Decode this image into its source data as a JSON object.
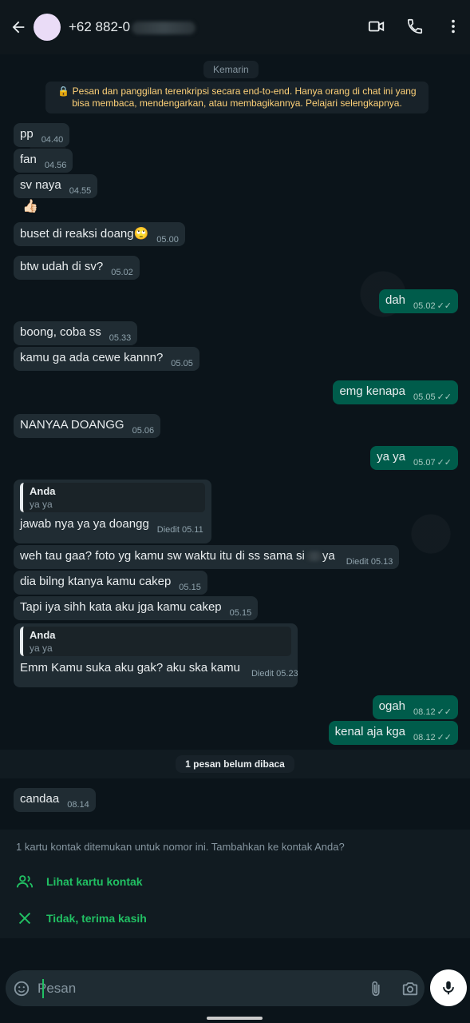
{
  "header": {
    "contact_name": "+62 882-0",
    "icons": [
      "back-arrow-icon",
      "video-call-icon",
      "phone-icon",
      "more-vert-icon"
    ]
  },
  "chat": {
    "date_chip": "Kemarin",
    "encryption_notice": "🔒 Pesan dan panggilan terenkripsi secara end-to-end. Hanya orang di chat ini yang bisa membaca, mendengarkan, atau membagikannya. Pelajari selengkapnya.",
    "messages": [
      {
        "text": "pp",
        "time": "04.40"
      },
      {
        "text": "fan",
        "time": "04.56"
      },
      {
        "text": "sv naya",
        "time": "04.55"
      },
      {
        "text": "👍🏻",
        "time": ""
      },
      {
        "text": "buset di reaksi doang🙄",
        "time": "05.00"
      },
      {
        "text": "btw udah di sv?",
        "time": "05.02"
      },
      {
        "text": "dah",
        "time": "05.02"
      },
      {
        "text": "boong, coba ss",
        "time": "05.33"
      },
      {
        "text": "kamu ga ada cewe kannn?",
        "time": "05.05"
      },
      {
        "text": "emg kenapa",
        "time": "05.05"
      },
      {
        "text": "NANYAA DOANGG",
        "time": "05.06"
      },
      {
        "text": "ya ya",
        "time": "05.07"
      },
      {
        "quote_author": "Anda",
        "quote_text": "ya ya",
        "text": "jawab nya ya ya doangg",
        "time": "Diedit 05.11"
      },
      {
        "text": "weh tau gaa? foto yg kamu sw waktu itu di ss sama si ",
        "text_end": "ya",
        "time": "Diedit 05.13"
      },
      {
        "text": "dia bilng ktanya kamu cakep",
        "time": "05.15"
      },
      {
        "text": "Tapi iya sihh kata aku jga kamu cakep",
        "time": "05.15"
      },
      {
        "quote_author": "Anda",
        "quote_text": "ya ya",
        "text": "Emm Kamu suka aku gak? aku ska kamu",
        "time": "Diedit 05.23"
      },
      {
        "text": "ogah",
        "time": "08.12"
      },
      {
        "text": "kenal aja kga",
        "time": "08.12"
      },
      {
        "text": "candaa",
        "time": "08.14"
      }
    ],
    "unread_banner": "1 pesan belum dibaca"
  },
  "contact_card": {
    "info": "1 kartu kontak ditemukan untuk nomor ini. Tambahkan ke kontak Anda?",
    "view_label": "Lihat kartu kontak",
    "decline_label": "Tidak, terima kasih"
  },
  "composer": {
    "placeholder": "Pesan"
  },
  "colors": {
    "accent": "#21c063",
    "incoming_bubble": "#202c33",
    "outgoing_bubble": "#005c4b",
    "background": "#0b141a"
  }
}
